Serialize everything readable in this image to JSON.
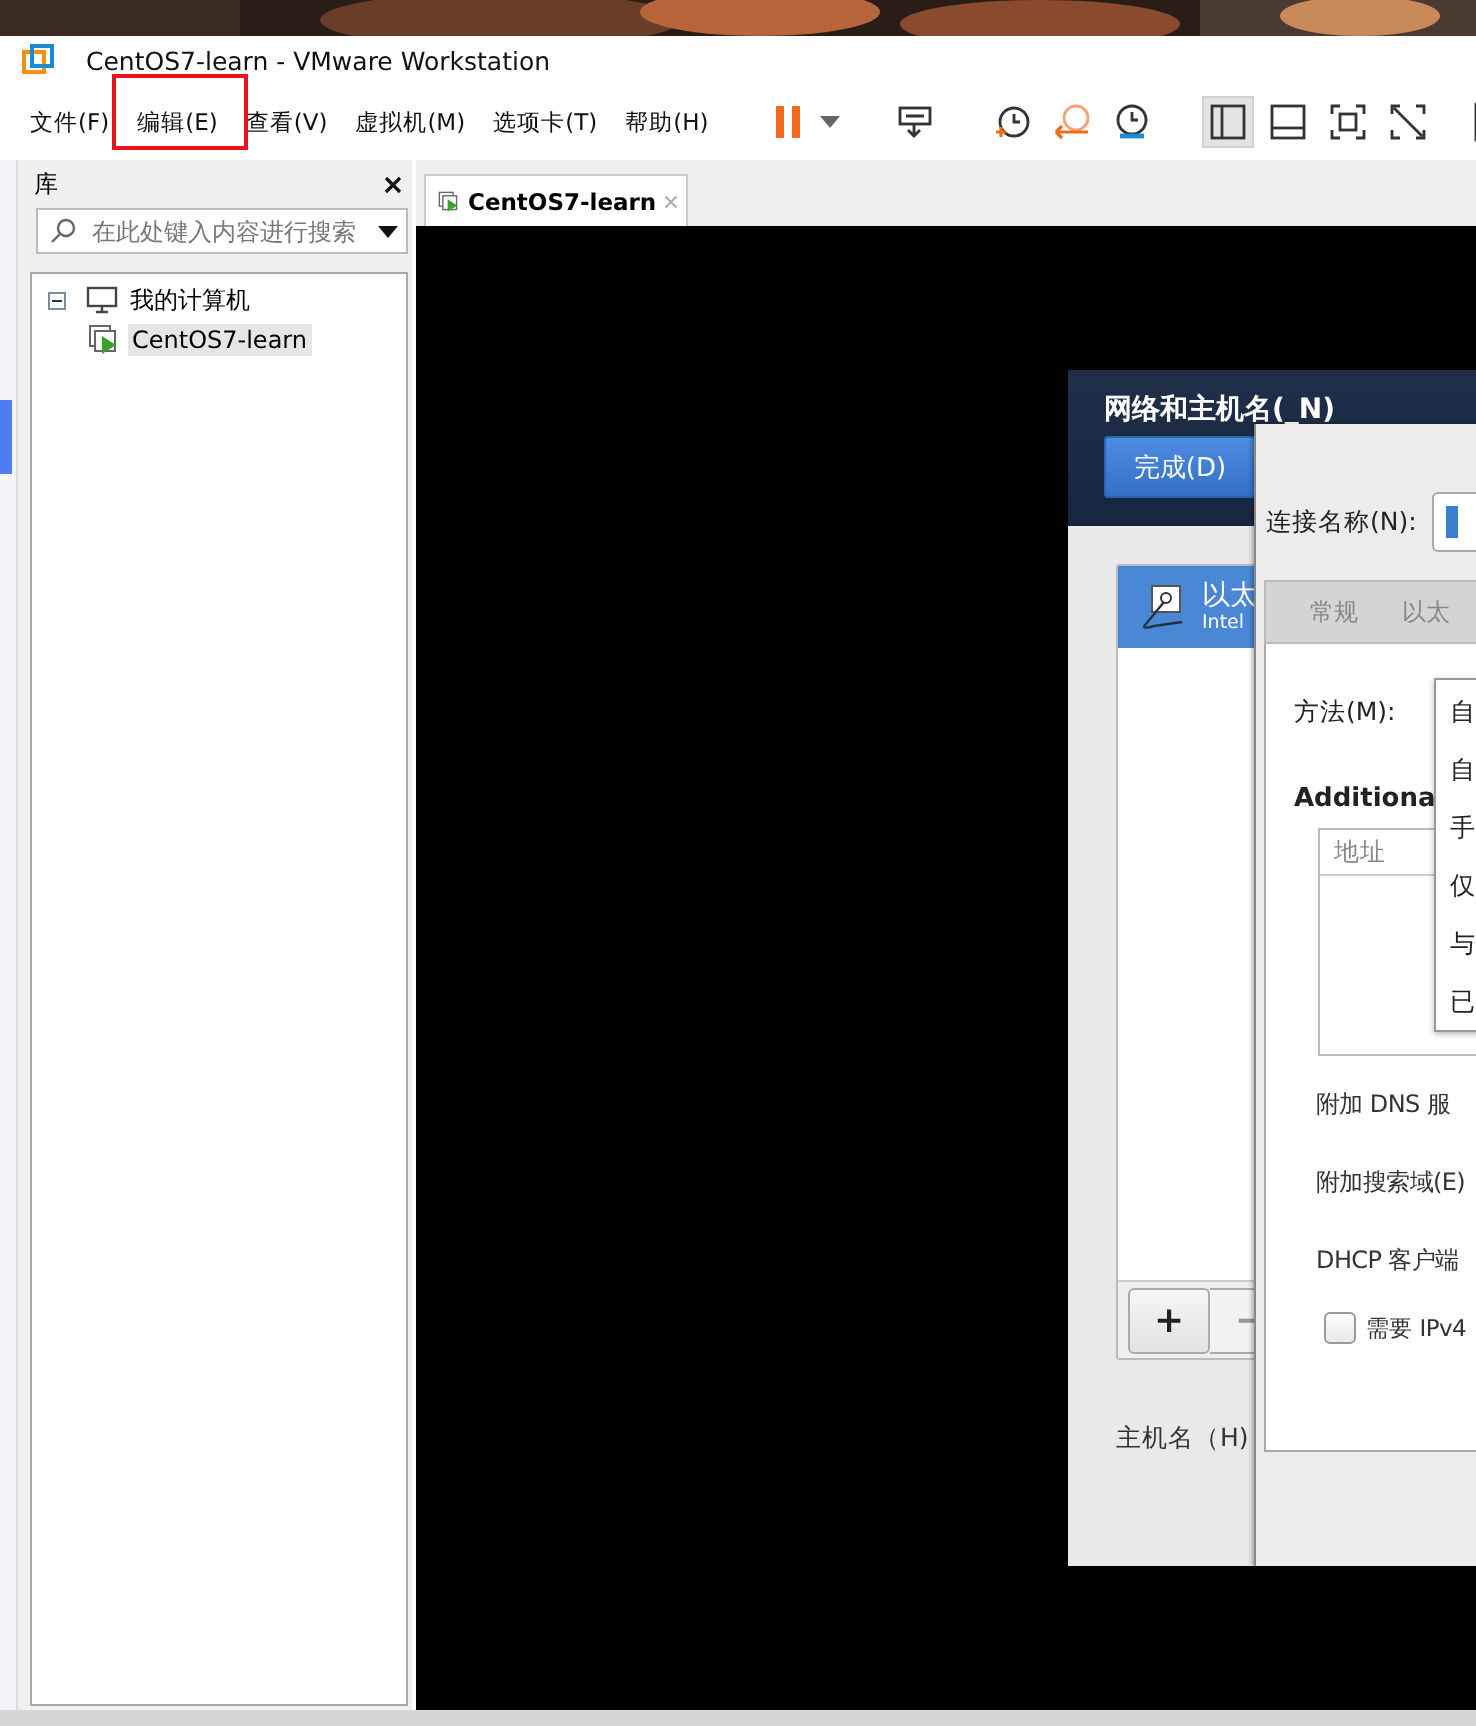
{
  "window": {
    "title": "CentOS7-learn - VMware Workstation"
  },
  "menu": [
    {
      "label": "文件(F)",
      "annotated": false
    },
    {
      "label": "编辑(E)",
      "annotated": true
    },
    {
      "label": "查看(V)",
      "annotated": false
    },
    {
      "label": "虚拟机(M)",
      "annotated": false
    },
    {
      "label": "选项卡(T)",
      "annotated": false
    },
    {
      "label": "帮助(H)",
      "annotated": false
    }
  ],
  "view_buttons": [
    {
      "selected": true
    },
    {
      "selected": false
    },
    {
      "selected": false
    },
    {
      "selected": false
    }
  ],
  "library": {
    "title": "库",
    "search": {
      "placeholder": "在此处键入内容进行搜索"
    },
    "tree": [
      {
        "label": "我的计算机",
        "expanded": true,
        "children": [
          {
            "label": "CentOS7-learn",
            "selected": true
          }
        ]
      }
    ]
  },
  "tabs": [
    {
      "label": "CentOS7-learn",
      "selected": true
    }
  ],
  "guest": {
    "spoke": {
      "title": "网络和主机名(_N)",
      "done_button": "完成(D)",
      "devices": [
        {
          "name": "以太",
          "detail": "Intel",
          "selected": true
        }
      ],
      "add_button": "+",
      "remove_button": "−",
      "hostname_label": "主机名（H)"
    },
    "dialog": {
      "connection_label": "连接名称(N):",
      "tabs": [
        {
          "label": "常规",
          "selected": false
        },
        {
          "label": "以太",
          "selected": false
        }
      ],
      "method_label": "方法(M):",
      "method_options": [
        "自",
        "自",
        "手",
        "仅",
        "与",
        "已"
      ],
      "additional_heading": "Additiona",
      "address_column": "地址",
      "dns_label": "附加 DNS 服",
      "search_domain_label": "附加搜索域(E)",
      "dhcp_label": "DHCP 客户端",
      "require_ipv4": {
        "label": "需要 IPv4",
        "checked": false
      }
    }
  }
}
